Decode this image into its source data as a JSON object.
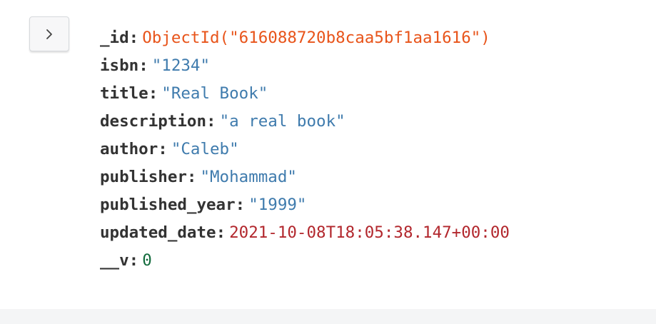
{
  "document": {
    "fields": [
      {
        "key": "_id",
        "value": "ObjectId(\"616088720b8caa5bf1aa1616\")",
        "type": "objectid"
      },
      {
        "key": "isbn",
        "value": "\"1234\"",
        "type": "string"
      },
      {
        "key": "title",
        "value": "\"Real Book\"",
        "type": "string"
      },
      {
        "key": "description",
        "value": "\"a real book\"",
        "type": "string"
      },
      {
        "key": "author",
        "value": "\"Caleb\"",
        "type": "string"
      },
      {
        "key": "publisher",
        "value": "\"Mohammad\"",
        "type": "string"
      },
      {
        "key": "published_year",
        "value": "\"1999\"",
        "type": "string"
      },
      {
        "key": "updated_date",
        "value": "2021-10-08T18:05:38.147+00:00",
        "type": "date"
      },
      {
        "key": "__v",
        "value": "0",
        "type": "number"
      }
    ],
    "separator": ":"
  },
  "expand_button": {
    "icon": "chevron-right-icon"
  },
  "colors": {
    "key": "#333333",
    "objectid": "#e8541a",
    "string": "#3f7bad",
    "date": "#b2272d",
    "number": "#126b3c"
  }
}
